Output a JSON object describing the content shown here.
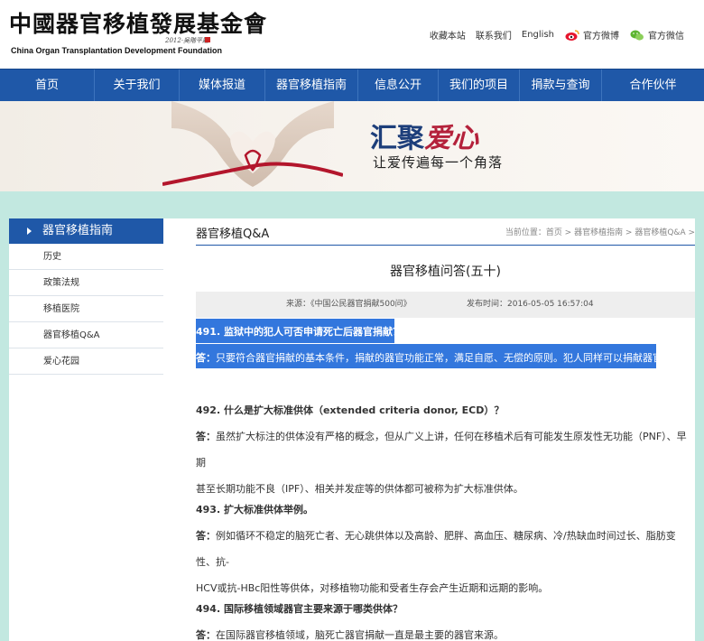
{
  "header": {
    "logo_cn": "中國器官移植發展基金會",
    "logo_sig": "2012·吳階平題",
    "logo_en": "China Organ Transplantation Development Foundation",
    "links": {
      "favorite": "收藏本站",
      "contact": "联系我们",
      "english": "English",
      "weibo": "官方微博",
      "wechat": "官方微信"
    }
  },
  "nav": {
    "items": [
      "首页",
      "关于我们",
      "媒体报道",
      "器官移植指南",
      "信息公开",
      "我们的项目",
      "捐款与查询",
      "合作伙伴"
    ]
  },
  "banner": {
    "title_a": "汇聚",
    "title_b": "爱心",
    "subtitle": "让爱传遍每一个角落"
  },
  "sidebar": {
    "heading": "器官移植指南",
    "items": [
      "历史",
      "政策法规",
      "移植医院",
      "器官移植Q&A",
      "爱心花园"
    ]
  },
  "main": {
    "section_title": "器官移植Q&A",
    "breadcrumb": "当前位置：首页 > 器官移植指南 > 器官移植Q&A >",
    "article_title": "器官移植问答(五十)",
    "source": "来源：《中国公民器官捐献500问》",
    "publish_time": "发布时间：2016-05-05 16:57:04",
    "qa": [
      {
        "q": "491. 监狱中的犯人可否申请死亡后器官捐献？",
        "a_label": "答：",
        "a": "只要符合器官捐献的基本条件，捐献的器官功能正常，满足自愿、无偿的原则。犯人同样可以捐献器官。"
      },
      {
        "q": "492. 什么是扩大标准供体（extended criteria donor, ECD）？",
        "a_label": "答：",
        "a1": "虽然扩大标注的供体没有严格的概念，但从广义上讲，任何在移植术后有可能发生原发性无功能（PNF）、早期",
        "a2": "甚至长期功能不良（IPF）、相关并发症等的供体都可被称为扩大标准供体。"
      },
      {
        "q": "493. 扩大标准供体举例。",
        "a_label": "答：",
        "a1": "例如循环不稳定的脑死亡者、无心跳供体以及高龄、肥胖、高血压、糖尿病、冷/热缺血时间过长、脂肪变性、抗-",
        "a2": "HCV或抗-HBc阳性等供体，对移植物功能和受者生存会产生近期和远期的影响。"
      },
      {
        "q": "494. 国际移植领域器官主要来源于哪类供体？",
        "a_label": "答：",
        "a": "在国际器官移植领域，脑死亡器官捐献一直是最主要的器官来源。"
      }
    ]
  }
}
